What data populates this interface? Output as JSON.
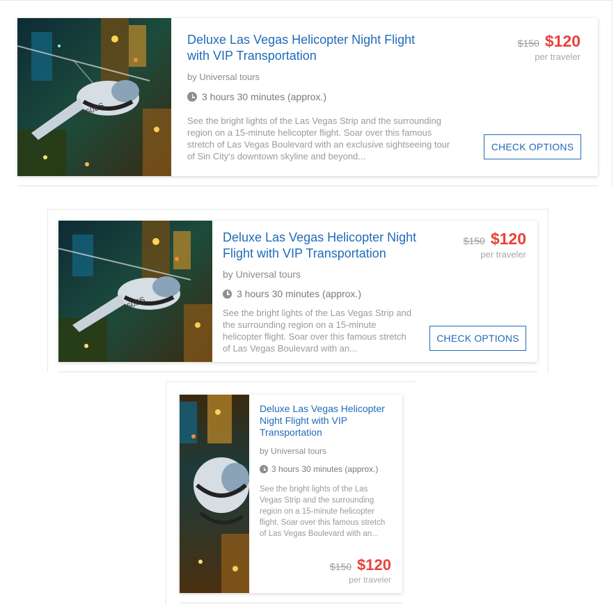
{
  "listing": {
    "title": "Deluxe Las Vegas Helicopter Night Flight with VIP Transportation",
    "operator": "by Universal tours",
    "duration": "3 hours 30 minutes (approx.)",
    "old_price": "$150",
    "price": "$120",
    "price_unit": "per traveler",
    "cta": "CHECK OPTIONS",
    "image_text": "N350ES"
  },
  "variants": [
    {
      "name": "large",
      "description": "See the bright lights of the Las Vegas Strip and the surrounding region on a 15-minute helicopter flight. Soar over this famous stretch of Las Vegas Boulevard with an exclusive sightseeing tour of Sin City's downtown skyline and beyond..."
    },
    {
      "name": "medium",
      "description": "See the bright lights of the Las Vegas Strip and the surrounding region on a 15-minute helicopter flight. Soar over this famous stretch of Las Vegas Boulevard with an..."
    },
    {
      "name": "small",
      "description": "See the bright lights of the Las Vegas Strip and the surrounding region on a 15-minute helicopter flight. Soar over this famous stretch of Las Vegas Boulevard with an..."
    }
  ],
  "colors": {
    "title": "#1f6bb8",
    "price": "#e8413a",
    "button_border": "#1f6bb8"
  },
  "icons": [
    "clock-icon"
  ]
}
